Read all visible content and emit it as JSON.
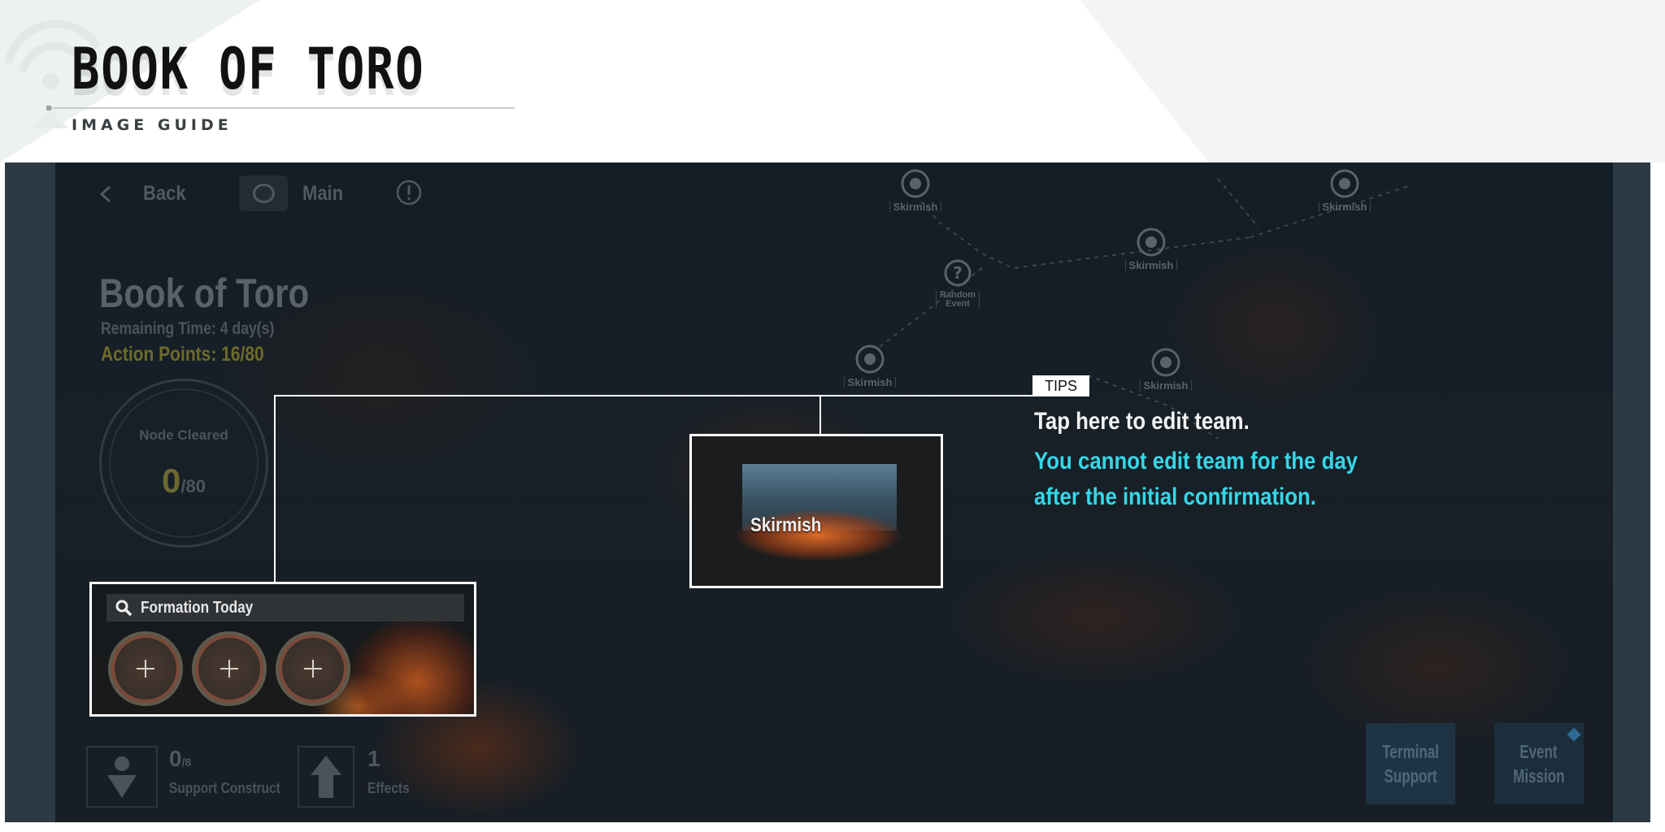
{
  "header": {
    "title": "BOOK OF TORO",
    "subtitle": "IMAGE GUIDE"
  },
  "game": {
    "topbar": {
      "back_label": "Back",
      "main_label": "Main"
    },
    "event": {
      "title": "Book of Toro",
      "remaining_time": "Remaining Time: 4 day(s)",
      "action_points": "Action Points: 16/80",
      "node_cleared_label": "Node Cleared",
      "node_cleared_count": "0",
      "node_cleared_total": "/80"
    },
    "map_nodes": {
      "skirmish_label": "Skirmish",
      "random_event_line1": "Random",
      "random_event_line2": "Event"
    },
    "bottom": {
      "support_count": "0",
      "support_total": "/8",
      "support_label": "Support Construct",
      "effects_count": "1",
      "effects_label": "Effects",
      "terminal_support_line1": "Terminal",
      "terminal_support_line2": "Support",
      "event_mission_line1": "Event",
      "event_mission_line2": "Mission"
    },
    "formation": {
      "label": "Formation Today"
    },
    "skirmish_card": {
      "label": "Skirmish"
    }
  },
  "tips": {
    "badge": "TIPS",
    "line1": "Tap here to edit team.",
    "line2": "You cannot edit team for the day",
    "line3": "after the initial confirmation."
  },
  "colors": {
    "accent_cyan": "#37d6e6",
    "action_points_olive": "#6d6b2b",
    "highlight_border": "#ffffff"
  }
}
